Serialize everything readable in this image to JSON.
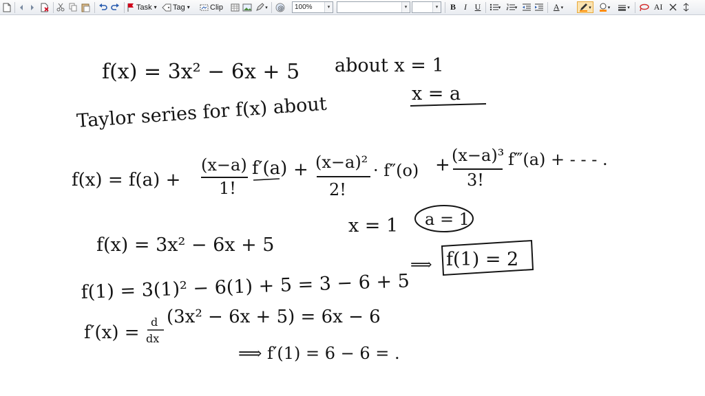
{
  "toolbar": {
    "task_label": "Task",
    "tag_label": "Tag",
    "clip_label": "Clip",
    "zoom_value": "100%",
    "font_value": "",
    "size_value": "",
    "bold_label": "B",
    "italic_label": "I",
    "underline_label": "U",
    "font_color_label": "A",
    "ai_label": "AI",
    "accent_color": "#f5a623",
    "highlight_color": "#ff8c00",
    "pen_color": "#d32f2f"
  },
  "notes": {
    "line1": "f(x) = 3x² − 6x + 5",
    "line1_about": "about  x = 1",
    "line2_prefix": "Taylor series for f(x) about",
    "line2_target": "x = a",
    "taylor_fx": "f(x) = f(a) +",
    "taylor_t1_num": "(x−a)",
    "taylor_t1_den": "1!",
    "taylor_t1_fn": "f′(a)",
    "taylor_plus1": "+",
    "taylor_t2_num": "(x−a)²",
    "taylor_t2_den": "2!",
    "taylor_t2_fn": "· f″(o)",
    "taylor_plus2": "+",
    "taylor_t3_num": "(x−a)³",
    "taylor_t3_den": "3!",
    "taylor_t3_fn": "f‴(a) + - - - .",
    "line4": "f(x) = 3x² − 6x + 5",
    "line4_x": "x = 1",
    "line4_a": "a = 1",
    "line5": "f(1) = 3(1)² − 6(1) + 5 = 3 − 6 + 5",
    "line5_arrow": "⟹",
    "line5_box": "f(1) = 2",
    "line6_lhs": "f′(x) =",
    "line6_d": "d",
    "line6_dx": "dx",
    "line6_rhs": "(3x² − 6x + 5)  =  6x − 6",
    "line7": "⟹   f′(1) = 6 − 6   = ."
  }
}
